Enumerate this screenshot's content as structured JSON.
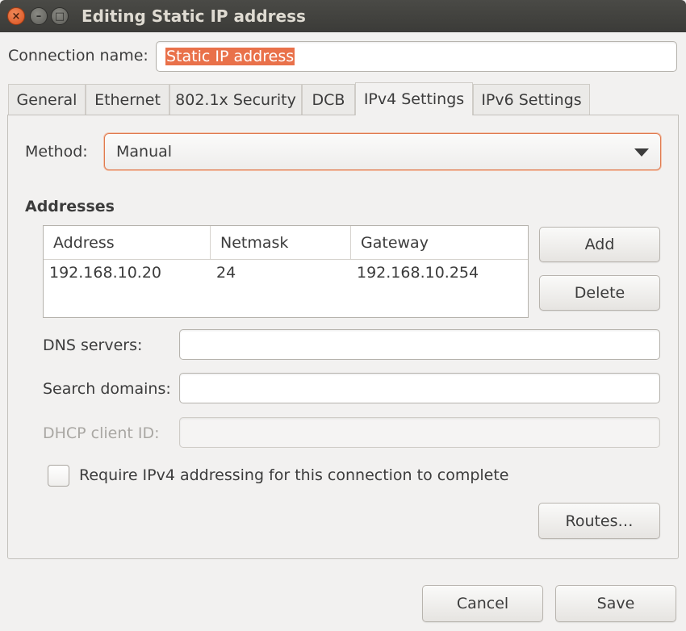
{
  "window": {
    "title": "Editing Static IP address",
    "close_glyph": "×",
    "minimize_glyph": "–",
    "maximize_glyph": "□"
  },
  "connection": {
    "label": "Connection name:",
    "value": "Static IP address"
  },
  "tabs": [
    {
      "label": "General",
      "active": false
    },
    {
      "label": "Ethernet",
      "active": false
    },
    {
      "label": "802.1x Security",
      "active": false
    },
    {
      "label": "DCB",
      "active": false
    },
    {
      "label": "IPv4 Settings",
      "active": true
    },
    {
      "label": "IPv6 Settings",
      "active": false
    }
  ],
  "method": {
    "label": "Method:",
    "value": "Manual"
  },
  "addresses": {
    "heading": "Addresses",
    "columns": [
      "Address",
      "Netmask",
      "Gateway"
    ],
    "rows": [
      [
        "192.168.10.20",
        "24",
        "192.168.10.254"
      ]
    ],
    "add_label": "Add",
    "delete_label": "Delete"
  },
  "dns": {
    "label": "DNS servers:",
    "value": ""
  },
  "search_domains": {
    "label": "Search domains:",
    "value": ""
  },
  "dhcp_client_id": {
    "label": "DHCP client ID:",
    "value": "",
    "disabled": true
  },
  "require_ipv4": {
    "label": "Require IPv4 addressing for this connection to complete",
    "checked": false
  },
  "routes_label": "Routes…",
  "footer": {
    "cancel_label": "Cancel",
    "save_label": "Save"
  },
  "colors": {
    "accent": "#e9714a",
    "titlebar": "#3c3b37"
  }
}
